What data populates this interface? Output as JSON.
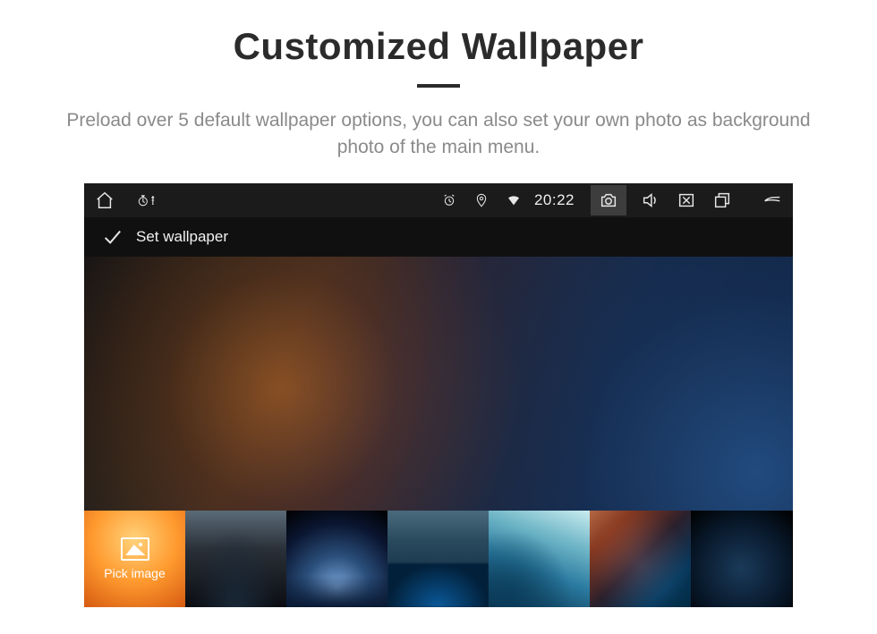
{
  "header": {
    "title": "Customized Wallpaper",
    "subtitle": "Preload over 5 default wallpaper options, you can also set your own photo as background photo of the main menu."
  },
  "status_bar": {
    "time": "20:22"
  },
  "secondary": {
    "label": "Set wallpaper"
  },
  "thumbs": {
    "pick_label": "Pick image"
  }
}
